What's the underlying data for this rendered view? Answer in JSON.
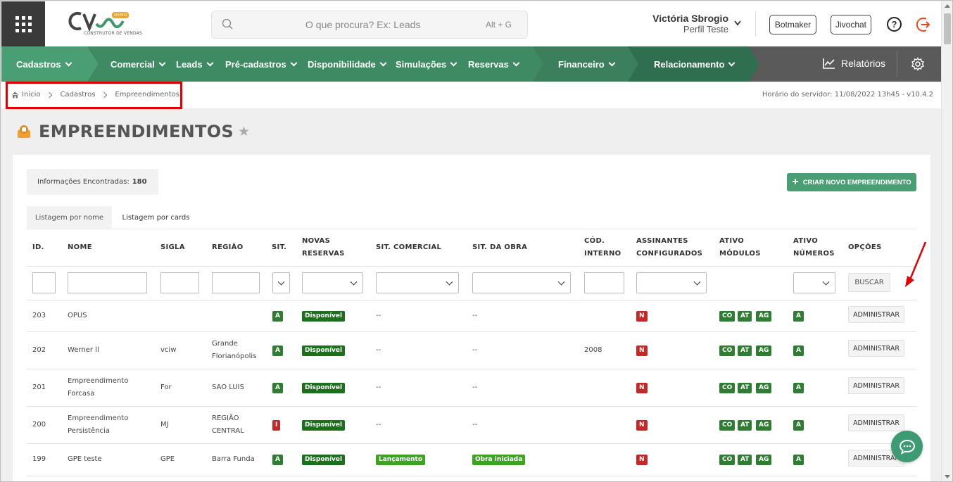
{
  "colors": {
    "nav_green": "#4a9e74",
    "nav_dark": "#5a5a5a",
    "accent_red": "#e00000",
    "badge_green": "#2e7d32",
    "badge_red": "#c62828"
  },
  "header": {
    "logo_sub": "CONSTRUTOR DE VENDAS",
    "logo_badge": "DEMO",
    "search_placeholder": "O que procura? Ex: Leads",
    "search_shortcut": "Alt + G",
    "user_name": "Victória Sbrogio",
    "user_role": "Perfil Teste",
    "btn_botmaker": "Botmaker",
    "btn_jivochat": "Jivochat",
    "help": "?"
  },
  "nav": {
    "items": [
      "Cadastros",
      "Comercial",
      "Leads",
      "Pré-cadastros",
      "Disponibilidade",
      "Simulações",
      "Reservas",
      "Financeiro",
      "Relacionamento"
    ],
    "relatorios": "Relatórios"
  },
  "breadcrumb": {
    "items": [
      "Início",
      "Cadastros",
      "Empreendimentos"
    ],
    "server_time": "Horário do servidor: 11/08/2022 13h45 - v10.4.2"
  },
  "page": {
    "title": "EMPREENDIMENTOS"
  },
  "info": {
    "label": "Informações Encontradas:",
    "count": "180"
  },
  "create_button": "CRIAR NOVO EMPREENDIMENTO",
  "tabs": [
    "Listagem por nome",
    "Listagem por cards"
  ],
  "table": {
    "headers": {
      "id": "ID.",
      "nome": "NOME",
      "sigla": "SIGLA",
      "regiao": "REGIÃO",
      "sit": "SIT.",
      "novas1": "NOVAS",
      "novas2": "RESERVAS",
      "sitcom": "SIT. COMERCIAL",
      "sitobra": "SIT. DA OBRA",
      "cod1": "CÓD.",
      "cod2": "INTERNO",
      "ass1": "ASSINANTES",
      "ass2": "CONFIGURADOS",
      "mod1": "ATIVO",
      "mod2": "MÓDULOS",
      "num1": "ATIVO",
      "num2": "NÚMEROS",
      "opcoes": "OPÇÕES"
    },
    "buscar": "BUSCAR",
    "adm_label": "ADMINISTRAR",
    "rows": [
      {
        "id": "203",
        "nome1": "OPUS",
        "nome2": "",
        "sigla": "",
        "regiao1": "",
        "regiao2": "",
        "sit": "A",
        "novas": "Disponível",
        "sitcom": "--",
        "sitobra": "--",
        "cod": "",
        "ass": "N",
        "mods": [
          "CO",
          "AT",
          "AG"
        ],
        "num": "A"
      },
      {
        "id": "202",
        "nome1": "Werner ll",
        "nome2": "",
        "sigla": "vciw",
        "regiao1": "Grande",
        "regiao2": "Florianópolis",
        "sit": "A",
        "novas": "Disponível",
        "sitcom": "--",
        "sitobra": "--",
        "cod": "2008",
        "ass": "N",
        "mods": [
          "CO",
          "AT",
          "AG"
        ],
        "num": "A"
      },
      {
        "id": "201",
        "nome1": "Empreendimento",
        "nome2": "Forcasa",
        "sigla": "For",
        "regiao1": "SAO LUIS",
        "regiao2": "",
        "sit": "A",
        "novas": "Disponível",
        "sitcom": "--",
        "sitobra": "--",
        "cod": "",
        "ass": "N",
        "mods": [
          "CO",
          "AT",
          "AG"
        ],
        "num": "A"
      },
      {
        "id": "200",
        "nome1": "Empreendimento",
        "nome2": "Persistência",
        "sigla": "MJ",
        "regiao1": "REGIÃO",
        "regiao2": "CENTRAL",
        "sit": "I",
        "novas": "Disponível",
        "sitcom": "--",
        "sitobra": "--",
        "cod": "",
        "ass": "N",
        "mods": [
          "CO",
          "AT",
          "AG"
        ],
        "num": "A"
      },
      {
        "id": "199",
        "nome1": "GPE teste",
        "nome2": "",
        "sigla": "GPE",
        "regiao1": "Barra Funda",
        "regiao2": "",
        "sit": "A",
        "novas": "Disponível",
        "sitcom": "Lançamento",
        "sitobra": "Obra iniciada",
        "cod": "",
        "ass": "N",
        "mods": [
          "CO",
          "AT",
          "AG"
        ],
        "num": "A"
      }
    ]
  }
}
